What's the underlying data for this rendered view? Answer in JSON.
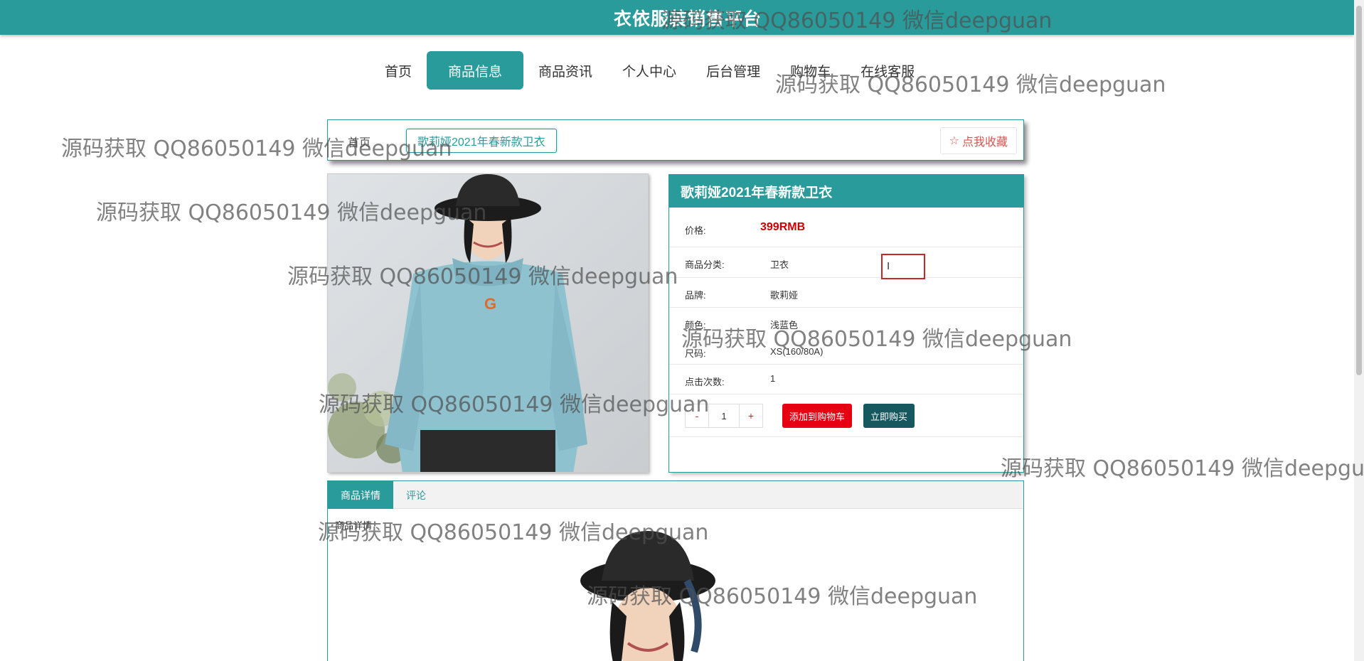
{
  "header": {
    "site_title": "衣依服装销售平台"
  },
  "nav": {
    "items": [
      {
        "label": "首页",
        "active": false
      },
      {
        "label": "商品信息",
        "active": true
      },
      {
        "label": "商品资讯",
        "active": false
      },
      {
        "label": "个人中心",
        "active": false
      },
      {
        "label": "后台管理",
        "active": false
      },
      {
        "label": "购物车",
        "active": false
      },
      {
        "label": "在线客服",
        "active": false
      }
    ]
  },
  "breadcrumb": {
    "home": "首页",
    "current": "歌莉娅2021年春新款卫衣",
    "favorite_label": "点我收藏"
  },
  "product": {
    "title": "歌莉娅2021年春新款卫衣",
    "price_label": "价格:",
    "price": "399RMB",
    "category_label": "商品分类:",
    "category": "卫衣",
    "brand_label": "品牌:",
    "brand": "歌莉娅",
    "color_label": "颜色:",
    "color": "浅蓝色",
    "size_label": "尺码:",
    "size": "XS(160/80A)",
    "clicks_label": "点击次数:",
    "clicks": "1",
    "quantity": "1",
    "minus": "-",
    "plus": "+",
    "add_to_cart": "添加到购物车",
    "buy_now": "立即购买"
  },
  "tabs": {
    "items": [
      {
        "label": "商品详情",
        "active": true
      },
      {
        "label": "评论",
        "active": false
      }
    ],
    "body_label": "商品详情"
  },
  "watermark": "源码获取 QQ86050149 微信deepguan",
  "colors": {
    "primary": "#2a9b9b",
    "price_red": "#cc0000",
    "cart_red": "#e60012",
    "buy_dark": "#17575e"
  }
}
